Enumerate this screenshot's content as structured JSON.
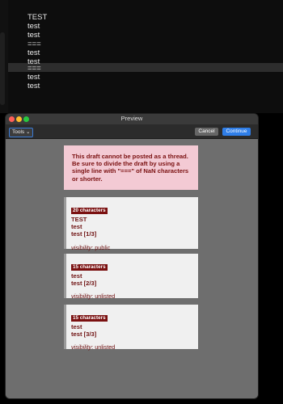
{
  "editor": {
    "lines": [
      "TEST",
      "test",
      "test",
      "===",
      "test",
      "test",
      "===",
      "test",
      "test"
    ]
  },
  "window": {
    "title": "Preview",
    "tools_label": "Tools",
    "cancel_label": "Cancel",
    "continue_label": "Continue"
  },
  "warning": {
    "text": "This draft cannot be posted as a thread. Be sure to divide the draft by using a single line with \"===\" of NaN characters or shorter."
  },
  "cards": [
    {
      "count": "20 characters",
      "lines": [
        "TEST",
        "test",
        "test [1/3]"
      ],
      "visibility_label": "visibility",
      "visibility_value": ": public"
    },
    {
      "count": "15 characters",
      "lines": [
        "test",
        "test [2/3]"
      ],
      "visibility_label": "visibility",
      "visibility_value": ": unlisted"
    },
    {
      "count": "15 characters",
      "lines": [
        "test",
        "test [3/3]"
      ],
      "visibility_label": "visibility",
      "visibility_value": ": unlisted"
    }
  ],
  "colors": {
    "accent": "#2f7ee8",
    "warning_bg": "#f3cad4",
    "badge_bg": "#7a1010"
  }
}
